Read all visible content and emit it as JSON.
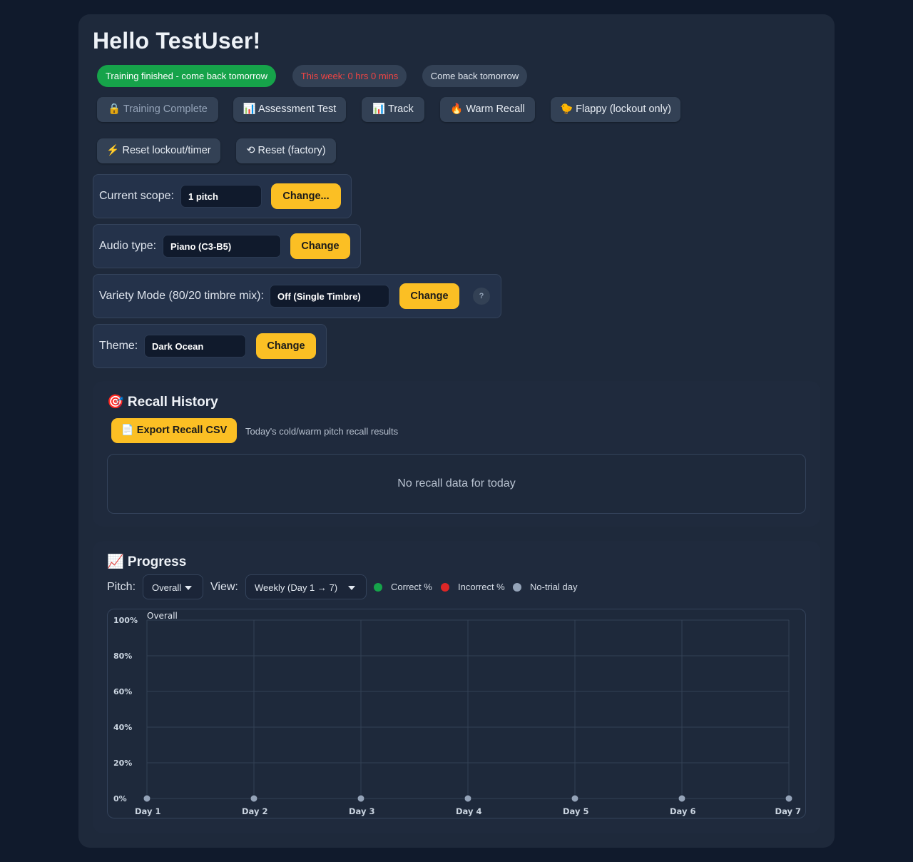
{
  "header": {
    "greeting": "Hello TestUser!"
  },
  "status": {
    "training_status": "Training finished - come back tomorrow",
    "week_time": "This week: 0 hrs 0 mins",
    "next_session": "Come back tomorrow"
  },
  "actions": {
    "training_complete": "🔒 Training Complete",
    "assessment_test": "📊 Assessment Test",
    "track": "📊 Track",
    "warm_recall": "🔥 Warm Recall",
    "flappy": "🐤 Flappy (lockout only)",
    "reset_lockout": "⚡ Reset lockout/timer",
    "reset_factory": "⟲ Reset (factory)"
  },
  "settings": {
    "scope": {
      "label": "Current scope:",
      "value": "1 pitch",
      "button": "Change..."
    },
    "audio": {
      "label": "Audio type:",
      "value": "Piano (C3-B5)",
      "button": "Change"
    },
    "variety": {
      "label": "Variety Mode (80/20 timbre mix):",
      "value": "Off (Single Timbre)",
      "button": "Change",
      "help": "?"
    },
    "theme": {
      "label": "Theme:",
      "value": "Dark Ocean",
      "button": "Change"
    }
  },
  "recall_history": {
    "title": "🎯 Recall History",
    "export_button": "📄 Export Recall CSV",
    "description": "Today's cold/warm pitch recall results",
    "empty_message": "No recall data for today"
  },
  "progress": {
    "title": "📈 Progress",
    "pitch_label": "Pitch:",
    "pitch_value": "Overall",
    "view_label": "View:",
    "view_value": "Weekly (Day 1 → 7)",
    "legend": [
      {
        "label": "Correct %",
        "color": "#16a34a"
      },
      {
        "label": "Incorrect %",
        "color": "#dc2626"
      },
      {
        "label": "No-trial day",
        "color": "#94a3b8"
      }
    ]
  },
  "colors": {
    "accent": "#fbbf24",
    "success": "#16a34a",
    "danger": "#ef4444",
    "panel": "#1e293b",
    "background": "#101a2c"
  },
  "chart_data": {
    "type": "line",
    "title": "Overall",
    "categories": [
      "Day 1",
      "Day 2",
      "Day 3",
      "Day 4",
      "Day 5",
      "Day 6",
      "Day 7"
    ],
    "yticks": [
      "0%",
      "20%",
      "40%",
      "60%",
      "80%",
      "100%"
    ],
    "ylim": [
      0,
      100
    ],
    "grid": true,
    "series": [
      {
        "name": "No-trial day",
        "values": [
          0,
          0,
          0,
          0,
          0,
          0,
          0
        ]
      }
    ]
  }
}
